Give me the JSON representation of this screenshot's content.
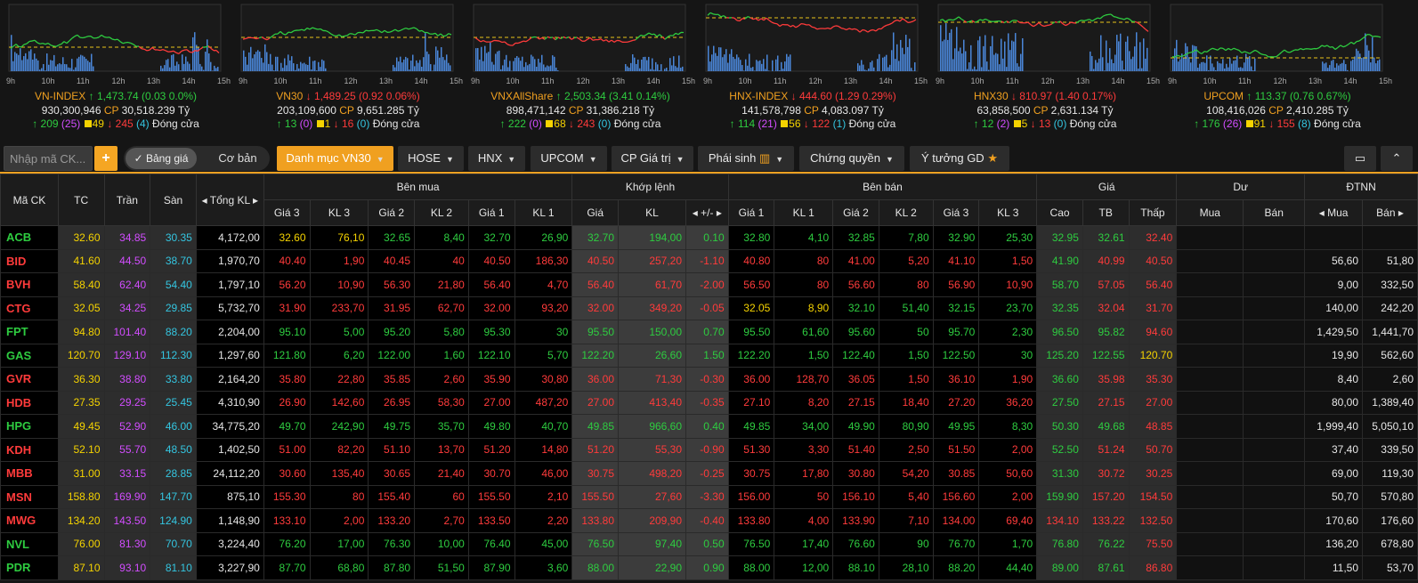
{
  "colors": {
    "accent": "#f0a020",
    "up": "#2ecc40",
    "down": "#ff3b3b",
    "ref": "#f5d300",
    "ceil": "#d24dff",
    "floor": "#34c5e0"
  },
  "time_ticks": [
    "9h",
    "10h",
    "11h",
    "12h",
    "13h",
    "14h",
    "15h"
  ],
  "indices": [
    {
      "name": "VN-INDEX",
      "arrow": "↑",
      "dir": "up",
      "value": "1,473.74",
      "change": "(0.03 0.0%)",
      "volume": "930,300,946",
      "cp_label": "CP",
      "value_traded": "30,518.239 Tỷ",
      "adv": "209",
      "ceil": "(25)",
      "unch": "49",
      "dec": "245",
      "floor": "(4)",
      "status": "Đóng cửa"
    },
    {
      "name": "VN30",
      "arrow": "↓",
      "dir": "down",
      "value": "1,489.25",
      "change": "(0.92 0.06%)",
      "volume": "203,109,600",
      "cp_label": "CP",
      "value_traded": "9,651.285 Tỷ",
      "adv": "13",
      "ceil": "(0)",
      "unch": "1",
      "dec": "16",
      "floor": "(0)",
      "status": "Đóng cửa"
    },
    {
      "name": "VNXAllShare",
      "arrow": "↑",
      "dir": "up",
      "value": "2,503.34",
      "change": "(3.41 0.14%)",
      "volume": "898,471,142",
      "cp_label": "CP",
      "value_traded": "31,386.218 Tỷ",
      "adv": "222",
      "ceil": "(0)",
      "unch": "68",
      "dec": "243",
      "floor": "(0)",
      "status": "Đóng cửa"
    },
    {
      "name": "HNX-INDEX",
      "arrow": "↓",
      "dir": "down",
      "value": "444.60",
      "change": "(1.29 0.29%)",
      "volume": "141,578,798",
      "cp_label": "CP",
      "value_traded": "4,083.097 Tỷ",
      "adv": "114",
      "ceil": "(21)",
      "unch": "56",
      "dec": "122",
      "floor": "(1)",
      "status": "Đóng cửa"
    },
    {
      "name": "HNX30",
      "arrow": "↓",
      "dir": "down",
      "value": "810.97",
      "change": "(1.40 0.17%)",
      "volume": "63,858,500",
      "cp_label": "CP",
      "value_traded": "2,631.134 Tỷ",
      "adv": "12",
      "ceil": "(2)",
      "unch": "5",
      "dec": "13",
      "floor": "(0)",
      "status": "Đóng cửa"
    },
    {
      "name": "UPCOM",
      "arrow": "↑",
      "dir": "up",
      "value": "113.37",
      "change": "(0.76 0.67%)",
      "volume": "108,416,026",
      "cp_label": "CP",
      "value_traded": "2,410.285 Tỷ",
      "adv": "176",
      "ceil": "(26)",
      "unch": "91",
      "dec": "155",
      "floor": "(8)",
      "status": "Đóng cửa"
    }
  ],
  "toolbar": {
    "search_placeholder": "Nhập mã CK...",
    "add": "+",
    "toggle_on": "Bảng giá",
    "toggle_off": "Cơ bản",
    "tabs": [
      "Danh mục VN30",
      "HOSE",
      "HNX",
      "UPCOM",
      "CP Giá trị",
      "Phái sinh",
      "Chứng quyền",
      "Ý tưởng GD"
    ]
  },
  "table": {
    "groups": {
      "symbol": "Mã CK",
      "ref": "TC",
      "ceil": "Trần",
      "floor": "Sàn",
      "total": "Tổng KL",
      "buy": "Bên mua",
      "match": "Khớp lệnh",
      "sell": "Bên bán",
      "price": "Giá",
      "remain": "Dư",
      "foreign": "ĐTNN"
    },
    "sub": [
      "Giá 3",
      "KL 3",
      "Giá 2",
      "KL 2",
      "Giá 1",
      "KL 1",
      "Giá",
      "KL",
      "+/-",
      "Giá 1",
      "KL 1",
      "Giá 2",
      "KL 2",
      "Giá 3",
      "KL 3",
      "Cao",
      "TB",
      "Thấp",
      "Mua",
      "Bán",
      "Mua",
      "Bán"
    ],
    "rows": [
      {
        "sym": "ACB",
        "c": "g",
        "tc": "32.60",
        "tran": "34.85",
        "san": "30.35",
        "tong": "4,172,00",
        "b": [
          "32.60",
          "76,10",
          "32.65",
          "8,40",
          "32.70",
          "26,90"
        ],
        "bc": [
          "y",
          "y",
          "g",
          "g",
          "g",
          "g"
        ],
        "m": [
          "32.70",
          "194,00",
          "0.10"
        ],
        "mc": "g",
        "s": [
          "32.80",
          "4,10",
          "32.85",
          "7,80",
          "32.90",
          "25,30"
        ],
        "sc": [
          "g",
          "g",
          "g",
          "g",
          "g",
          "g"
        ],
        "p": [
          "32.95",
          "32.61",
          "32.40"
        ],
        "pc": [
          "g",
          "g",
          "r"
        ],
        "du": [
          "",
          ""
        ],
        "nn": [
          "",
          ""
        ]
      },
      {
        "sym": "BID",
        "c": "r",
        "tc": "41.60",
        "tran": "44.50",
        "san": "38.70",
        "tong": "1,970,70",
        "b": [
          "40.40",
          "1,90",
          "40.45",
          "40",
          "40.50",
          "186,30"
        ],
        "bc": [
          "r",
          "r",
          "r",
          "r",
          "r",
          "r"
        ],
        "m": [
          "40.50",
          "257,20",
          "-1.10"
        ],
        "mc": "r",
        "s": [
          "40.80",
          "80",
          "41.00",
          "5,20",
          "41.10",
          "1,50"
        ],
        "sc": [
          "r",
          "r",
          "r",
          "r",
          "r",
          "r"
        ],
        "p": [
          "41.90",
          "40.99",
          "40.50"
        ],
        "pc": [
          "g",
          "r",
          "r"
        ],
        "du": [
          "",
          ""
        ],
        "nn": [
          "56,60",
          "51,80"
        ]
      },
      {
        "sym": "BVH",
        "c": "r",
        "tc": "58.40",
        "tran": "62.40",
        "san": "54.40",
        "tong": "1,797,10",
        "b": [
          "56.20",
          "10,90",
          "56.30",
          "21,80",
          "56.40",
          "4,70"
        ],
        "bc": [
          "r",
          "r",
          "r",
          "r",
          "r",
          "r"
        ],
        "m": [
          "56.40",
          "61,70",
          "-2.00"
        ],
        "mc": "r",
        "s": [
          "56.50",
          "80",
          "56.60",
          "80",
          "56.90",
          "10,90"
        ],
        "sc": [
          "r",
          "r",
          "r",
          "r",
          "r",
          "r"
        ],
        "p": [
          "58.70",
          "57.05",
          "56.40"
        ],
        "pc": [
          "g",
          "r",
          "r"
        ],
        "du": [
          "",
          ""
        ],
        "nn": [
          "9,00",
          "332,50"
        ]
      },
      {
        "sym": "CTG",
        "c": "r",
        "tc": "32.05",
        "tran": "34.25",
        "san": "29.85",
        "tong": "5,732,70",
        "b": [
          "31.90",
          "233,70",
          "31.95",
          "62,70",
          "32.00",
          "93,20"
        ],
        "bc": [
          "r",
          "r",
          "r",
          "r",
          "r",
          "r"
        ],
        "m": [
          "32.00",
          "349,20",
          "-0.05"
        ],
        "mc": "r",
        "s": [
          "32.05",
          "8,90",
          "32.10",
          "51,40",
          "32.15",
          "23,70"
        ],
        "sc": [
          "y",
          "y",
          "g",
          "g",
          "g",
          "g"
        ],
        "p": [
          "32.35",
          "32.04",
          "31.70"
        ],
        "pc": [
          "g",
          "r",
          "r"
        ],
        "du": [
          "",
          ""
        ],
        "nn": [
          "140,00",
          "242,20"
        ]
      },
      {
        "sym": "FPT",
        "c": "g",
        "tc": "94.80",
        "tran": "101.40",
        "san": "88.20",
        "tong": "2,204,00",
        "b": [
          "95.10",
          "5,00",
          "95.20",
          "5,80",
          "95.30",
          "30"
        ],
        "bc": [
          "g",
          "g",
          "g",
          "g",
          "g",
          "g"
        ],
        "m": [
          "95.50",
          "150,00",
          "0.70"
        ],
        "mc": "g",
        "s": [
          "95.50",
          "61,60",
          "95.60",
          "50",
          "95.70",
          "2,30"
        ],
        "sc": [
          "g",
          "g",
          "g",
          "g",
          "g",
          "g"
        ],
        "p": [
          "96.50",
          "95.82",
          "94.60"
        ],
        "pc": [
          "g",
          "g",
          "r"
        ],
        "du": [
          "",
          ""
        ],
        "nn": [
          "1,429,50",
          "1,441,70"
        ]
      },
      {
        "sym": "GAS",
        "c": "g",
        "tc": "120.70",
        "tran": "129.10",
        "san": "112.30",
        "tong": "1,297,60",
        "b": [
          "121.80",
          "6,20",
          "122.00",
          "1,60",
          "122.10",
          "5,70"
        ],
        "bc": [
          "g",
          "g",
          "g",
          "g",
          "g",
          "g"
        ],
        "m": [
          "122.20",
          "26,60",
          "1.50"
        ],
        "mc": "g",
        "s": [
          "122.20",
          "1,50",
          "122.40",
          "1,50",
          "122.50",
          "30"
        ],
        "sc": [
          "g",
          "g",
          "g",
          "g",
          "g",
          "g"
        ],
        "p": [
          "125.20",
          "122.55",
          "120.70"
        ],
        "pc": [
          "g",
          "g",
          "y"
        ],
        "du": [
          "",
          ""
        ],
        "nn": [
          "19,90",
          "562,60"
        ]
      },
      {
        "sym": "GVR",
        "c": "r",
        "tc": "36.30",
        "tran": "38.80",
        "san": "33.80",
        "tong": "2,164,20",
        "b": [
          "35.80",
          "22,80",
          "35.85",
          "2,60",
          "35.90",
          "30,80"
        ],
        "bc": [
          "r",
          "r",
          "r",
          "r",
          "r",
          "r"
        ],
        "m": [
          "36.00",
          "71,30",
          "-0.30"
        ],
        "mc": "r",
        "s": [
          "36.00",
          "128,70",
          "36.05",
          "1,50",
          "36.10",
          "1,90"
        ],
        "sc": [
          "r",
          "r",
          "r",
          "r",
          "r",
          "r"
        ],
        "p": [
          "36.60",
          "35.98",
          "35.30"
        ],
        "pc": [
          "g",
          "r",
          "r"
        ],
        "du": [
          "",
          ""
        ],
        "nn": [
          "8,40",
          "2,60"
        ]
      },
      {
        "sym": "HDB",
        "c": "r",
        "tc": "27.35",
        "tran": "29.25",
        "san": "25.45",
        "tong": "4,310,90",
        "b": [
          "26.90",
          "142,60",
          "26.95",
          "58,30",
          "27.00",
          "487,20"
        ],
        "bc": [
          "r",
          "r",
          "r",
          "r",
          "r",
          "r"
        ],
        "m": [
          "27.00",
          "413,40",
          "-0.35"
        ],
        "mc": "r",
        "s": [
          "27.10",
          "8,20",
          "27.15",
          "18,40",
          "27.20",
          "36,20"
        ],
        "sc": [
          "r",
          "r",
          "r",
          "r",
          "r",
          "r"
        ],
        "p": [
          "27.50",
          "27.15",
          "27.00"
        ],
        "pc": [
          "g",
          "r",
          "r"
        ],
        "du": [
          "",
          ""
        ],
        "nn": [
          "80,00",
          "1,389,40"
        ]
      },
      {
        "sym": "HPG",
        "c": "g",
        "tc": "49.45",
        "tran": "52.90",
        "san": "46.00",
        "tong": "34,775,20",
        "b": [
          "49.70",
          "242,90",
          "49.75",
          "35,70",
          "49.80",
          "40,70"
        ],
        "bc": [
          "g",
          "g",
          "g",
          "g",
          "g",
          "g"
        ],
        "m": [
          "49.85",
          "966,60",
          "0.40"
        ],
        "mc": "g",
        "s": [
          "49.85",
          "34,00",
          "49.90",
          "80,90",
          "49.95",
          "8,30"
        ],
        "sc": [
          "g",
          "g",
          "g",
          "g",
          "g",
          "g"
        ],
        "p": [
          "50.30",
          "49.68",
          "48.85"
        ],
        "pc": [
          "g",
          "g",
          "r"
        ],
        "du": [
          "",
          ""
        ],
        "nn": [
          "1,999,40",
          "5,050,10"
        ]
      },
      {
        "sym": "KDH",
        "c": "r",
        "tc": "52.10",
        "tran": "55.70",
        "san": "48.50",
        "tong": "1,402,50",
        "b": [
          "51.00",
          "82,20",
          "51.10",
          "13,70",
          "51.20",
          "14,80"
        ],
        "bc": [
          "r",
          "r",
          "r",
          "r",
          "r",
          "r"
        ],
        "m": [
          "51.20",
          "55,30",
          "-0.90"
        ],
        "mc": "r",
        "s": [
          "51.30",
          "3,30",
          "51.40",
          "2,50",
          "51.50",
          "2,00"
        ],
        "sc": [
          "r",
          "r",
          "r",
          "r",
          "r",
          "r"
        ],
        "p": [
          "52.50",
          "51.24",
          "50.70"
        ],
        "pc": [
          "g",
          "r",
          "r"
        ],
        "du": [
          "",
          ""
        ],
        "nn": [
          "37,40",
          "339,50"
        ]
      },
      {
        "sym": "MBB",
        "c": "r",
        "tc": "31.00",
        "tran": "33.15",
        "san": "28.85",
        "tong": "24,112,20",
        "b": [
          "30.60",
          "135,40",
          "30.65",
          "21,40",
          "30.70",
          "46,00"
        ],
        "bc": [
          "r",
          "r",
          "r",
          "r",
          "r",
          "r"
        ],
        "m": [
          "30.75",
          "498,20",
          "-0.25"
        ],
        "mc": "r",
        "s": [
          "30.75",
          "17,80",
          "30.80",
          "54,20",
          "30.85",
          "50,60"
        ],
        "sc": [
          "r",
          "r",
          "r",
          "r",
          "r",
          "r"
        ],
        "p": [
          "31.30",
          "30.72",
          "30.25"
        ],
        "pc": [
          "g",
          "r",
          "r"
        ],
        "du": [
          "",
          ""
        ],
        "nn": [
          "69,00",
          "119,30"
        ]
      },
      {
        "sym": "MSN",
        "c": "r",
        "tc": "158.80",
        "tran": "169.90",
        "san": "147.70",
        "tong": "875,10",
        "b": [
          "155.30",
          "80",
          "155.40",
          "60",
          "155.50",
          "2,10"
        ],
        "bc": [
          "r",
          "r",
          "r",
          "r",
          "r",
          "r"
        ],
        "m": [
          "155.50",
          "27,60",
          "-3.30"
        ],
        "mc": "r",
        "s": [
          "156.00",
          "50",
          "156.10",
          "5,40",
          "156.60",
          "2,00"
        ],
        "sc": [
          "r",
          "r",
          "r",
          "r",
          "r",
          "r"
        ],
        "p": [
          "159.90",
          "157.20",
          "154.50"
        ],
        "pc": [
          "g",
          "r",
          "r"
        ],
        "du": [
          "",
          ""
        ],
        "nn": [
          "50,70",
          "570,80"
        ]
      },
      {
        "sym": "MWG",
        "c": "r",
        "tc": "134.20",
        "tran": "143.50",
        "san": "124.90",
        "tong": "1,148,90",
        "b": [
          "133.10",
          "2,00",
          "133.20",
          "2,70",
          "133.50",
          "2,20"
        ],
        "bc": [
          "r",
          "r",
          "r",
          "r",
          "r",
          "r"
        ],
        "m": [
          "133.80",
          "209,90",
          "-0.40"
        ],
        "mc": "r",
        "s": [
          "133.80",
          "4,00",
          "133.90",
          "7,10",
          "134.00",
          "69,40"
        ],
        "sc": [
          "r",
          "r",
          "r",
          "r",
          "r",
          "r"
        ],
        "p": [
          "134.10",
          "133.22",
          "132.50"
        ],
        "pc": [
          "r",
          "r",
          "r"
        ],
        "du": [
          "",
          ""
        ],
        "nn": [
          "170,60",
          "176,60"
        ]
      },
      {
        "sym": "NVL",
        "c": "g",
        "tc": "76.00",
        "tran": "81.30",
        "san": "70.70",
        "tong": "3,224,40",
        "b": [
          "76.20",
          "17,00",
          "76.30",
          "10,00",
          "76.40",
          "45,00"
        ],
        "bc": [
          "g",
          "g",
          "g",
          "g",
          "g",
          "g"
        ],
        "m": [
          "76.50",
          "97,40",
          "0.50"
        ],
        "mc": "g",
        "s": [
          "76.50",
          "17,40",
          "76.60",
          "90",
          "76.70",
          "1,70"
        ],
        "sc": [
          "g",
          "g",
          "g",
          "g",
          "g",
          "g"
        ],
        "p": [
          "76.80",
          "76.22",
          "75.50"
        ],
        "pc": [
          "g",
          "g",
          "r"
        ],
        "du": [
          "",
          ""
        ],
        "nn": [
          "136,20",
          "678,80"
        ]
      },
      {
        "sym": "PDR",
        "c": "g",
        "tc": "87.10",
        "tran": "93.10",
        "san": "81.10",
        "tong": "3,227,90",
        "b": [
          "87.70",
          "68,80",
          "87.80",
          "51,50",
          "87.90",
          "3,60"
        ],
        "bc": [
          "g",
          "g",
          "g",
          "g",
          "g",
          "g"
        ],
        "m": [
          "88.00",
          "22,90",
          "0.90"
        ],
        "mc": "g",
        "s": [
          "88.00",
          "12,00",
          "88.10",
          "28,10",
          "88.20",
          "44,40"
        ],
        "sc": [
          "g",
          "g",
          "g",
          "g",
          "g",
          "g"
        ],
        "p": [
          "89.00",
          "87.61",
          "86.80"
        ],
        "pc": [
          "g",
          "g",
          "r"
        ],
        "du": [
          "",
          ""
        ],
        "nn": [
          "11,50",
          "53,70"
        ]
      }
    ]
  }
}
